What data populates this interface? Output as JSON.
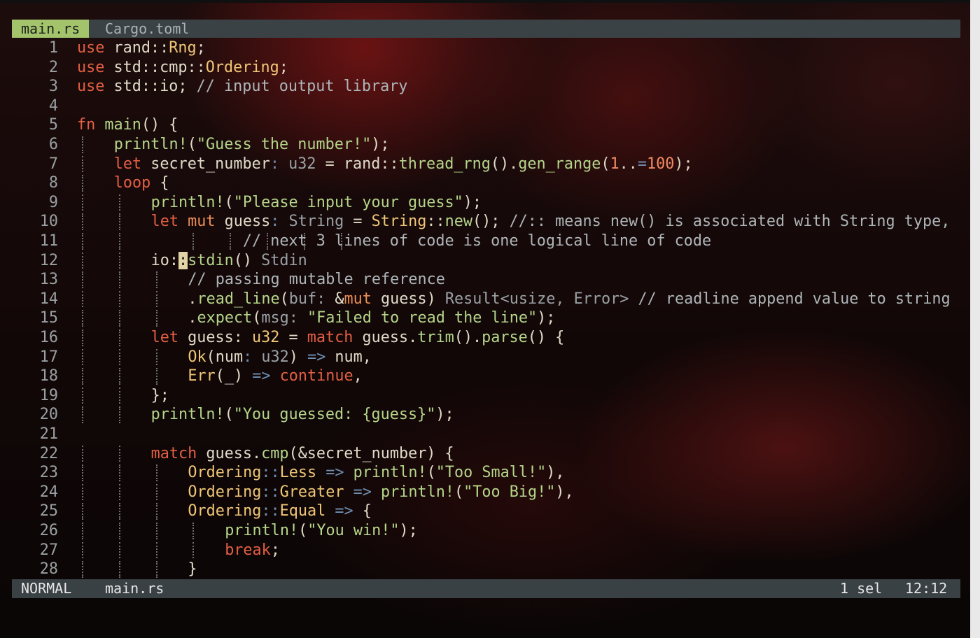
{
  "tabs": [
    {
      "label": "main.rs",
      "active": true
    },
    {
      "label": "Cargo.toml",
      "active": false
    }
  ],
  "status": {
    "mode": "NORMAL",
    "file": "main.rs",
    "selection": "1 sel",
    "position": "12:12"
  },
  "colors": {
    "active_tab": "#a4c46c",
    "tabbar": "#3b4246",
    "statusbar": "#3a4144",
    "keyword": "#e35f44",
    "function": "#b5d68a",
    "type": "#f0c777",
    "comment": "#aeb5b8",
    "cursor": "#e2d4a4"
  },
  "code": [
    {
      "n": "1",
      "indent": 0,
      "tokens": [
        [
          "kw",
          "use"
        ],
        [
          "pl",
          " rand::"
        ],
        [
          "ty",
          "Rng"
        ],
        [
          "pl",
          ";"
        ]
      ]
    },
    {
      "n": "2",
      "indent": 0,
      "tokens": [
        [
          "kw",
          "use"
        ],
        [
          "pl",
          " std::cmp::"
        ],
        [
          "ty",
          "Ordering"
        ],
        [
          "pl",
          ";"
        ]
      ]
    },
    {
      "n": "3",
      "indent": 0,
      "tokens": [
        [
          "kw",
          "use"
        ],
        [
          "pl",
          " std::io; "
        ],
        [
          "cm",
          "// input output library"
        ]
      ]
    },
    {
      "n": "4",
      "indent": 0,
      "tokens": []
    },
    {
      "n": "5",
      "indent": 0,
      "tokens": [
        [
          "kw",
          "fn"
        ],
        [
          "fn",
          " main"
        ],
        [
          "pl",
          "() {"
        ]
      ]
    },
    {
      "n": "6",
      "indent": 1,
      "tokens": [
        [
          "fn",
          "println!"
        ],
        [
          "pl",
          "("
        ],
        [
          "str",
          "\"Guess the number!\""
        ],
        [
          "pl",
          ");"
        ]
      ]
    },
    {
      "n": "7",
      "indent": 1,
      "tokens": [
        [
          "kw",
          "let"
        ],
        [
          "pl",
          " secret_number"
        ],
        [
          "op",
          ":"
        ],
        [
          "hint",
          " u32"
        ],
        [
          "pl",
          " = rand::"
        ],
        [
          "fn",
          "thread_rng"
        ],
        [
          "pl",
          "()."
        ],
        [
          "fn",
          "gen_range"
        ],
        [
          "pl",
          "("
        ],
        [
          "num",
          "1"
        ],
        [
          "pl",
          ".."
        ],
        [
          "op",
          "="
        ],
        [
          "num",
          "100"
        ],
        [
          "pl",
          ");"
        ]
      ]
    },
    {
      "n": "8",
      "indent": 1,
      "tokens": [
        [
          "kw",
          "loop"
        ],
        [
          "pl",
          " {"
        ]
      ]
    },
    {
      "n": "9",
      "indent": 2,
      "tokens": [
        [
          "fn",
          "println!"
        ],
        [
          "pl",
          "("
        ],
        [
          "str",
          "\"Please input your guess\""
        ],
        [
          "pl",
          ");"
        ]
      ]
    },
    {
      "n": "10",
      "indent": 2,
      "tokens": [
        [
          "kw",
          "let"
        ],
        [
          "kw2",
          " mut"
        ],
        [
          "pl",
          " guess"
        ],
        [
          "op",
          ":"
        ],
        [
          "hint",
          " String"
        ],
        [
          "pl",
          " = "
        ],
        [
          "ty",
          "String"
        ],
        [
          "pl",
          "::"
        ],
        [
          "fn",
          "new"
        ],
        [
          "pl",
          "(); "
        ],
        [
          "cm",
          "//:: means new() is associated with String type,"
        ]
      ]
    },
    {
      "n": "11",
      "indent": 2,
      "tokens": [
        [
          "cm",
          "          // next 3 lines of code is one logical line of code"
        ]
      ],
      "extra_guides": [
        3,
        4,
        5,
        6,
        7
      ]
    },
    {
      "n": "12",
      "indent": 2,
      "tokens": [
        [
          "pl",
          "io:"
        ],
        [
          "cursor",
          ":"
        ],
        [
          "fn",
          "stdin"
        ],
        [
          "pl",
          "() "
        ],
        [
          "hint",
          "Stdin"
        ]
      ]
    },
    {
      "n": "13",
      "indent": 3,
      "tokens": [
        [
          "cm",
          "// passing mutable reference"
        ]
      ]
    },
    {
      "n": "14",
      "indent": 3,
      "tokens": [
        [
          "pl",
          "."
        ],
        [
          "fn",
          "read_line"
        ],
        [
          "pl",
          "("
        ],
        [
          "hint",
          "buf: "
        ],
        [
          "pl",
          "&"
        ],
        [
          "kw2",
          "mut"
        ],
        [
          "pl",
          " guess) "
        ],
        [
          "hint",
          "Result<usize, Error>"
        ],
        [
          "cm",
          " // readline append value to string"
        ]
      ]
    },
    {
      "n": "15",
      "indent": 3,
      "tokens": [
        [
          "pl",
          "."
        ],
        [
          "fn",
          "expect"
        ],
        [
          "pl",
          "("
        ],
        [
          "hint",
          "msg: "
        ],
        [
          "str",
          "\"Failed to read the line\""
        ],
        [
          "pl",
          ");"
        ]
      ]
    },
    {
      "n": "16",
      "indent": 2,
      "tokens": [
        [
          "kw",
          "let"
        ],
        [
          "pl",
          " guess: "
        ],
        [
          "ty",
          "u32"
        ],
        [
          "pl",
          " = "
        ],
        [
          "kw",
          "match"
        ],
        [
          "pl",
          " guess."
        ],
        [
          "fn",
          "trim"
        ],
        [
          "pl",
          "()."
        ],
        [
          "fn",
          "parse"
        ],
        [
          "pl",
          "() {"
        ]
      ]
    },
    {
      "n": "17",
      "indent": 3,
      "tokens": [
        [
          "ty",
          "Ok"
        ],
        [
          "pl",
          "(num"
        ],
        [
          "op",
          ":"
        ],
        [
          "hint",
          " u32"
        ],
        [
          "pl",
          ") "
        ],
        [
          "op",
          "=>"
        ],
        [
          "pl",
          " num,"
        ]
      ]
    },
    {
      "n": "18",
      "indent": 3,
      "tokens": [
        [
          "ty",
          "Err"
        ],
        [
          "pl",
          "(_) "
        ],
        [
          "op",
          "=>"
        ],
        [
          "kw",
          " continue"
        ],
        [
          "pl",
          ","
        ]
      ]
    },
    {
      "n": "19",
      "indent": 2,
      "tokens": [
        [
          "pl",
          "};"
        ]
      ]
    },
    {
      "n": "20",
      "indent": 2,
      "tokens": [
        [
          "fn",
          "println!"
        ],
        [
          "pl",
          "("
        ],
        [
          "str",
          "\"You guessed: {guess}\""
        ],
        [
          "pl",
          ");"
        ]
      ]
    },
    {
      "n": "21",
      "indent": 0,
      "tokens": []
    },
    {
      "n": "22",
      "indent": 2,
      "tokens": [
        [
          "kw",
          "match"
        ],
        [
          "pl",
          " guess."
        ],
        [
          "fn",
          "cmp"
        ],
        [
          "pl",
          "(&secret_number) {"
        ]
      ]
    },
    {
      "n": "23",
      "indent": 3,
      "tokens": [
        [
          "ty",
          "Ordering"
        ],
        [
          "op",
          "::"
        ],
        [
          "ty",
          "Less"
        ],
        [
          "op",
          " =>"
        ],
        [
          "fn",
          " println!"
        ],
        [
          "pl",
          "("
        ],
        [
          "str",
          "\"Too Small!\""
        ],
        [
          "pl",
          "),"
        ]
      ]
    },
    {
      "n": "24",
      "indent": 3,
      "tokens": [
        [
          "ty",
          "Ordering"
        ],
        [
          "op",
          "::"
        ],
        [
          "ty",
          "Greater"
        ],
        [
          "op",
          " =>"
        ],
        [
          "fn",
          " println!"
        ],
        [
          "pl",
          "("
        ],
        [
          "str",
          "\"Too Big!\""
        ],
        [
          "pl",
          "),"
        ]
      ]
    },
    {
      "n": "25",
      "indent": 3,
      "tokens": [
        [
          "ty",
          "Ordering"
        ],
        [
          "op",
          "::"
        ],
        [
          "ty",
          "Equal"
        ],
        [
          "op",
          " =>"
        ],
        [
          "pl",
          " {"
        ]
      ]
    },
    {
      "n": "26",
      "indent": 4,
      "tokens": [
        [
          "fn",
          "println!"
        ],
        [
          "pl",
          "("
        ],
        [
          "str",
          "\"You win!\""
        ],
        [
          "pl",
          ");"
        ]
      ]
    },
    {
      "n": "27",
      "indent": 4,
      "tokens": [
        [
          "kw",
          "break"
        ],
        [
          "pl",
          ";"
        ]
      ]
    },
    {
      "n": "28",
      "indent": 3,
      "tokens": [
        [
          "pl",
          "}"
        ]
      ]
    }
  ]
}
